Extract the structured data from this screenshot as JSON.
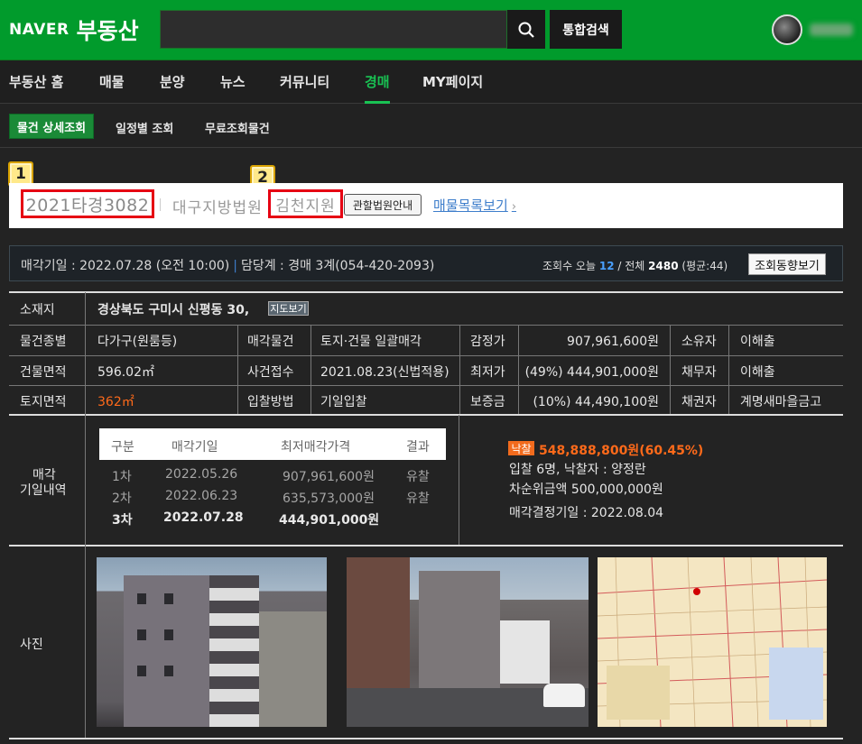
{
  "header": {
    "logo_naver": "NAVER",
    "logo_service": "부동산",
    "search_placeholder": "",
    "total_search_label": "통합검색"
  },
  "main_nav": [
    {
      "label": "부동산 홈"
    },
    {
      "label": "매물"
    },
    {
      "label": "분양"
    },
    {
      "label": "뉴스"
    },
    {
      "label": "커뮤니티"
    },
    {
      "label": "경매",
      "active": true
    },
    {
      "label": "MY페이지"
    }
  ],
  "sub_nav": [
    {
      "label": "물건 상세조회",
      "active": true
    },
    {
      "label": "일정별 조회"
    },
    {
      "label": "무료조회물건"
    }
  ],
  "case": {
    "case_number": "2021타경3082",
    "court": "대구지방법원",
    "branch": "김천지원",
    "court_info_button": "관할법원안내",
    "list_link": "매물목록보기",
    "badge1": "1",
    "badge2": "2"
  },
  "info_bar": {
    "sale_date_text": "매각기일 : 2022.07.28 (오전 10:00)",
    "separator": "|",
    "dept_text": "담당계 : 경매 3계(054-420-2093)",
    "views_label": "조회수 오늘",
    "views_today": "12",
    "views_total_label": "/ 전체",
    "views_total": "2480",
    "views_avg": "(평균:44)",
    "trend_button": "조회동향보기"
  },
  "details": {
    "location_label": "소재지",
    "location_value": "경상북도 구미시 신평동 30,",
    "map_button": "지도보기",
    "rows": [
      {
        "l1": "물건종별",
        "v1": "다가구(원룸등)",
        "l2": "매각물건",
        "v2": "토지·건물 일괄매각",
        "l3": "감정가",
        "v3": "907,961,600원",
        "l4": "소유자",
        "v4": "이해출"
      },
      {
        "l1": "건물면적",
        "v1": "596.02㎡",
        "l2": "사건접수",
        "v2": "2021.08.23(신법적용)",
        "l3": "최저가",
        "v3": "(49%) 444,901,000원",
        "l4": "채무자",
        "v4": "이해출"
      },
      {
        "l1": "토지면적",
        "v1": "362㎡",
        "l2": "입찰방법",
        "v2": "기일입찰",
        "l3": "보증금",
        "v3": "(10%) 44,490,100원",
        "l4": "채권자",
        "v4": "계명새마을금고"
      }
    ]
  },
  "history": {
    "section_label_1": "매각",
    "section_label_2": "기일내역",
    "headers": [
      "구분",
      "매각기일",
      "최저매각가격",
      "결과"
    ],
    "rows": [
      {
        "round": "1차",
        "date": "2022.05.26",
        "price": "907,961,600원",
        "result": "유찰"
      },
      {
        "round": "2차",
        "date": "2022.06.23",
        "price": "635,573,000원",
        "result": "유찰"
      },
      {
        "round": "3차",
        "date": "2022.07.28",
        "price": "444,901,000원",
        "result": ""
      }
    ]
  },
  "result": {
    "badge": "낙찰",
    "price": "548,888,800원(60.45%)",
    "bidders": "입찰 6명, 낙찰자 : 양정란",
    "second": "차순위금액 500,000,000원",
    "decision_date": "매각결정기일 : 2022.08.04"
  },
  "photos": {
    "section_label": "사진"
  },
  "colors": {
    "naver_green": "#019b2c",
    "active_green": "#19c253",
    "highlight_red": "#e60012",
    "orange": "#ff6a1a",
    "link_blue": "#3e7ecb"
  }
}
